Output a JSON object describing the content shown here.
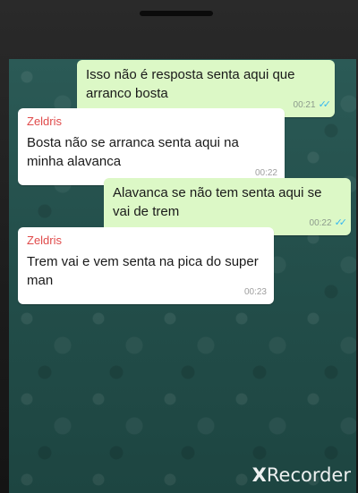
{
  "chat": {
    "messages": [
      {
        "direction": "out",
        "text": "Isso não é resposta senta aqui que arranco bosta",
        "time": "00:21",
        "read_ticks": "✓✓"
      },
      {
        "direction": "in",
        "sender": "Zeldris",
        "text": "Bosta não se arranca senta aqui na minha alavanca",
        "time": "00:22"
      },
      {
        "direction": "out",
        "text": "Alavanca se não tem senta aqui se vai de trem",
        "time": "00:22",
        "read_ticks": "✓✓"
      },
      {
        "direction": "in",
        "sender": "Zeldris",
        "text": "Trem vai e vem senta na pica do super man",
        "time": "00:23"
      }
    ]
  },
  "watermark": {
    "prefix": "X",
    "text": "Recorder"
  },
  "colors": {
    "outgoing_bubble": "#dcf8c6",
    "incoming_bubble": "#ffffff",
    "sender_name": "#e04b4b",
    "read_ticks": "#34b7f1",
    "chat_background": "#24504c"
  }
}
